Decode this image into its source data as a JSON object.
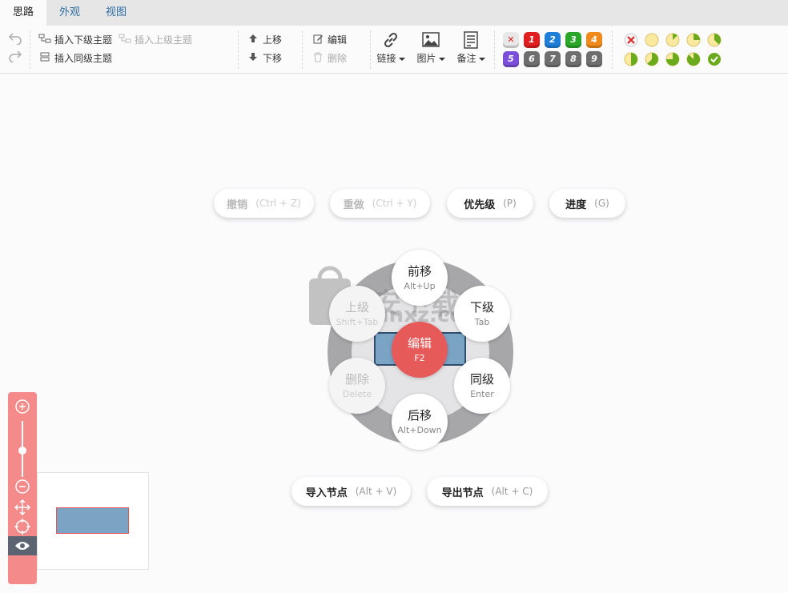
{
  "tabs": [
    {
      "label": "思路",
      "active": true
    },
    {
      "label": "外观",
      "active": false
    },
    {
      "label": "视图",
      "active": false
    }
  ],
  "toolbar": {
    "undo_icon": "undo-icon",
    "redo_icon": "redo-icon",
    "insert_child": "插入下级主题",
    "insert_parent": "插入上级主题",
    "insert_sibling": "插入同级主题",
    "move_up": "上移",
    "move_down": "下移",
    "edit": "编辑",
    "delete": "删除",
    "link": "链接",
    "image": "图片",
    "note": "备注",
    "priorities": [
      "1",
      "2",
      "3",
      "4",
      "5",
      "6",
      "7",
      "8",
      "9"
    ],
    "priority_colors": [
      "#e02020",
      "#1f7fd8",
      "#2aa62a",
      "#f08a1c",
      "#7b4fd8",
      "#6e6e6e",
      "#6e6e6e",
      "#6e6e6e",
      "#6e6e6e"
    ],
    "progress_count": 10
  },
  "menu": {
    "undo": {
      "label": "撤销",
      "shortcut": "(Ctrl + Z)"
    },
    "redo": {
      "label": "重做",
      "shortcut": "(Ctrl + Y)"
    },
    "priority": {
      "label": "优先级",
      "shortcut": "(P)"
    },
    "progress": {
      "label": "进度",
      "shortcut": "(G)"
    },
    "import": {
      "label": "导入节点",
      "shortcut": "(Alt + V)"
    },
    "export": {
      "label": "导出节点",
      "shortcut": "(Alt + C)"
    }
  },
  "radial": {
    "up": {
      "label": "前移",
      "shortcut": "Alt+Up"
    },
    "parent": {
      "label": "上级",
      "shortcut": "Shift+Tab"
    },
    "child": {
      "label": "下级",
      "shortcut": "Tab"
    },
    "edit": {
      "label": "编辑",
      "shortcut": "F2"
    },
    "delete": {
      "label": "删除",
      "shortcut": "Delete"
    },
    "sibling": {
      "label": "同级",
      "shortcut": "Enter"
    },
    "down": {
      "label": "后移",
      "shortcut": "Alt+Down"
    }
  },
  "watermark": "anxz.com",
  "colors": {
    "accent_red": "#e65a5a",
    "nav_bg": "#f58a8a",
    "node_fill": "#7aa3c4",
    "tab_link": "#2f6ea5"
  }
}
